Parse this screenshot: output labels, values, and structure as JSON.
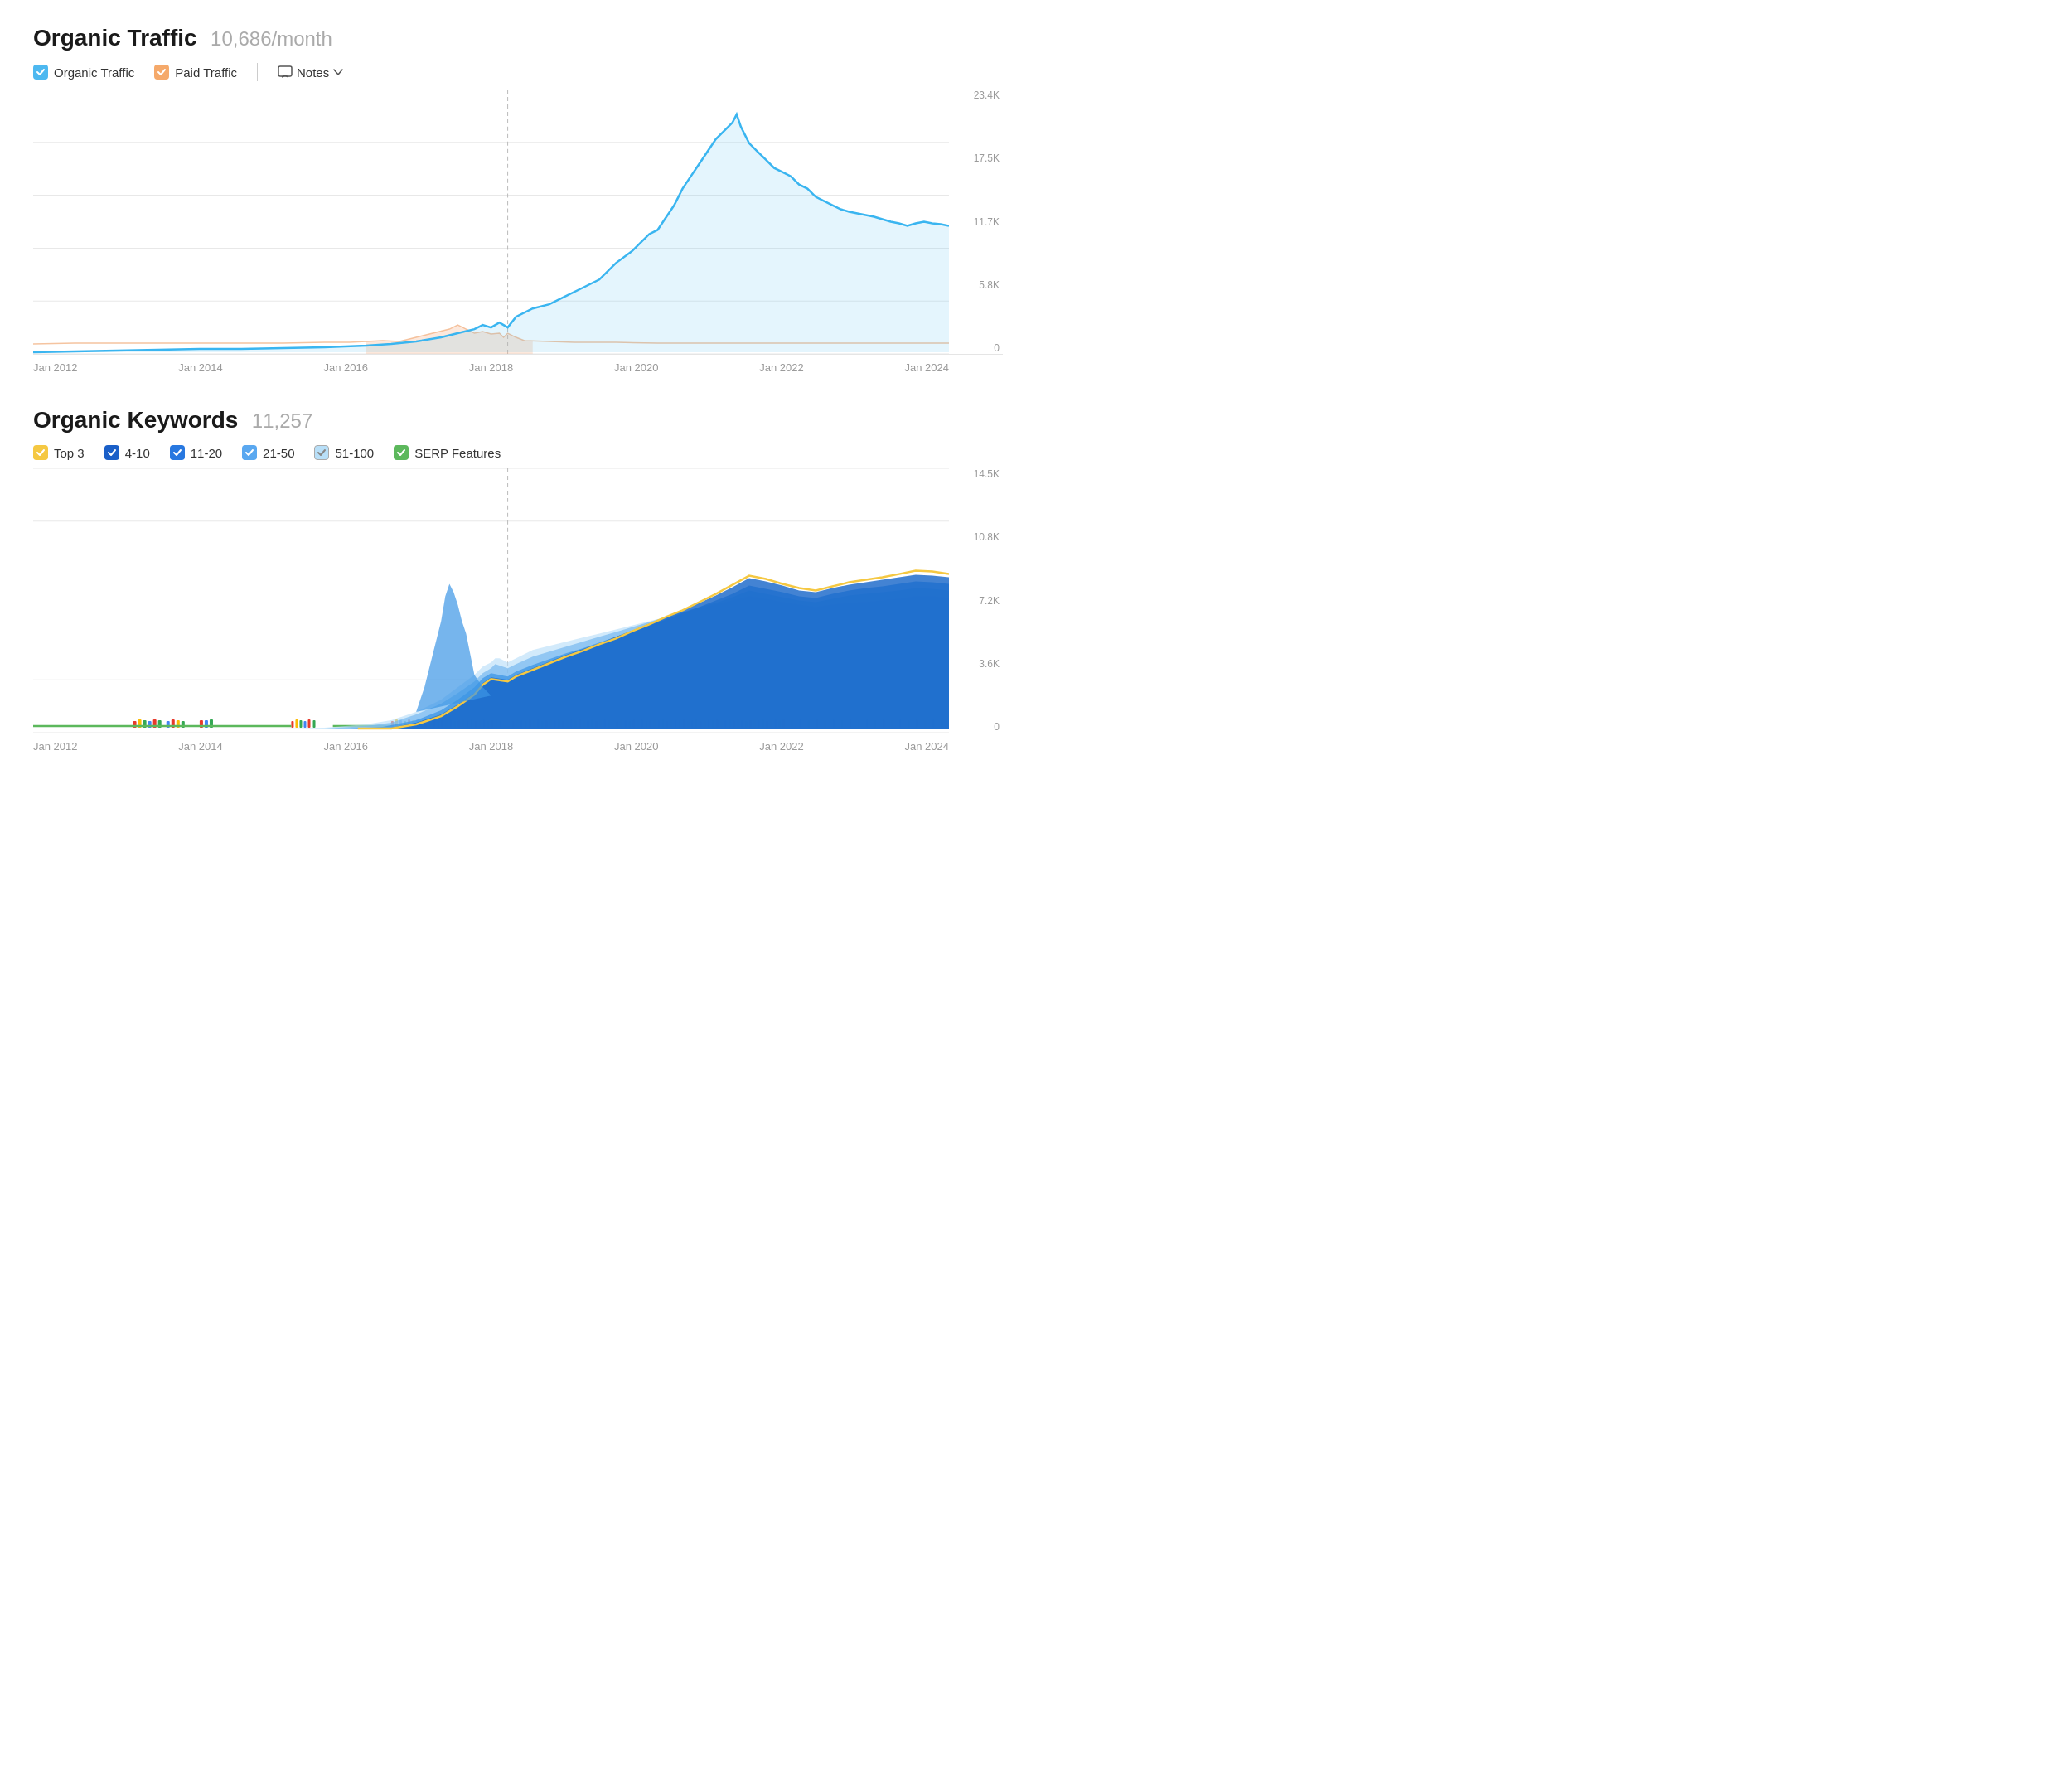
{
  "organic_traffic": {
    "title": "Organic Traffic",
    "value": "10,686/month",
    "legend": [
      {
        "label": "Organic Traffic",
        "color": "#4db8f0",
        "checked": true
      },
      {
        "label": "Paid Traffic",
        "color": "#f5a96a",
        "checked": true
      }
    ],
    "notes_label": "Notes",
    "y_labels": [
      "23.4K",
      "17.5K",
      "11.7K",
      "5.8K",
      "0"
    ],
    "x_labels": [
      "Jan 2012",
      "Jan 2014",
      "Jan 2016",
      "Jan 2018",
      "Jan 2020",
      "Jan 2022",
      "Jan 2024"
    ]
  },
  "organic_keywords": {
    "title": "Organic Keywords",
    "value": "11,257",
    "legend": [
      {
        "label": "Top 3",
        "color": "#f5c842",
        "checked": true
      },
      {
        "label": "4-10",
        "color": "#1a5fc8",
        "checked": true
      },
      {
        "label": "11-20",
        "color": "#2878e0",
        "checked": true
      },
      {
        "label": "21-50",
        "color": "#5aa8f0",
        "checked": true
      },
      {
        "label": "51-100",
        "color": "#a0d4f8",
        "checked": true
      },
      {
        "label": "SERP Features",
        "color": "#5cb85c",
        "checked": true
      }
    ],
    "y_labels": [
      "14.5K",
      "10.8K",
      "7.2K",
      "3.6K",
      "0"
    ],
    "x_labels": [
      "Jan 2012",
      "Jan 2014",
      "Jan 2016",
      "Jan 2018",
      "Jan 2020",
      "Jan 2022",
      "Jan 2024"
    ]
  }
}
